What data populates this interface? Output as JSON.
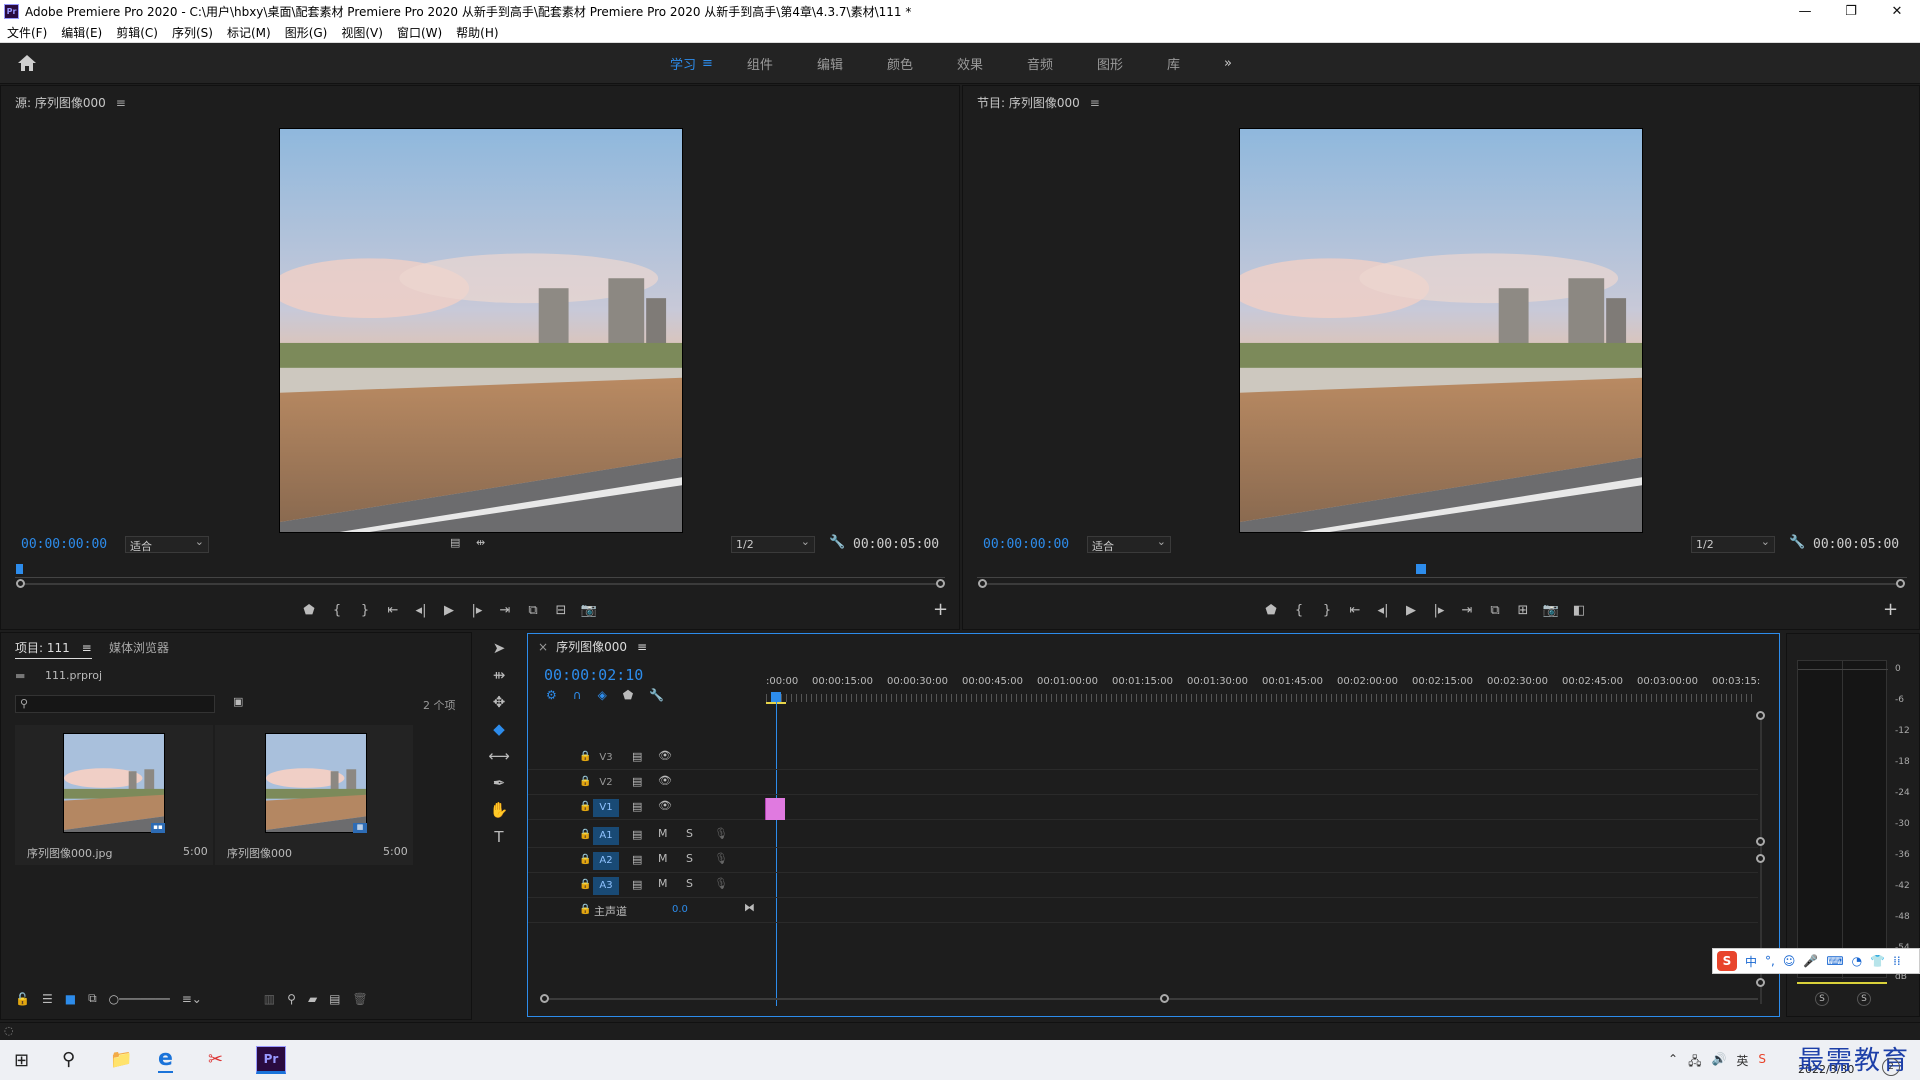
{
  "window": {
    "title": "Adobe Premiere Pro 2020 - C:\\用户\\hbxy\\桌面\\配套素材 Premiere Pro 2020 从新手到高手\\配套素材 Premiere Pro 2020 从新手到高手\\第4章\\4.3.7\\素材\\111 *",
    "app_icon_label": "Pr",
    "minimize": "—",
    "restore": "❐",
    "close": "✕"
  },
  "menu": [
    "文件(F)",
    "编辑(E)",
    "剪辑(C)",
    "序列(S)",
    "标记(M)",
    "图形(G)",
    "视图(V)",
    "窗口(W)",
    "帮助(H)"
  ],
  "workspaces": {
    "items": [
      "学习",
      "组件",
      "编辑",
      "颜色",
      "效果",
      "音频",
      "图形",
      "库"
    ],
    "active": "学习",
    "more": "»"
  },
  "source_monitor": {
    "title": "源: 序列图像000",
    "menu_icon": "≡",
    "timecode_in": "00:00:00:00",
    "fit": "适合",
    "resolution": "1/2",
    "duration": "00:00:05:00"
  },
  "program_monitor": {
    "title": "节目: 序列图像000",
    "menu_icon": "≡",
    "timecode_in": "00:00:00:00",
    "fit": "适合",
    "resolution": "1/2",
    "duration": "00:00:05:00"
  },
  "project": {
    "tab_project": "项目: 111",
    "tab_menu": "≡",
    "tab_media": "媒体浏览器",
    "file": "111.prproj",
    "count": "2 个项",
    "items": [
      {
        "name": "序列图像000.jpg",
        "duration": "5:00"
      },
      {
        "name": "序列图像000",
        "duration": "5:00"
      }
    ]
  },
  "timeline": {
    "tab": "序列图像000",
    "tab_menu": "≡",
    "timecode": "00:00:02:10",
    "ruler": [
      ":00:00",
      "00:00:15:00",
      "00:00:30:00",
      "00:00:45:00",
      "00:01:00:00",
      "00:01:15:00",
      "00:01:30:00",
      "00:01:45:00",
      "00:02:00:00",
      "00:02:15:00",
      "00:02:30:00",
      "00:02:45:00",
      "00:03:00:00",
      "00:03:15:"
    ],
    "video_tracks": [
      "V3",
      "V2",
      "V1"
    ],
    "audio_tracks": [
      "A1",
      "A2",
      "A3"
    ],
    "mute": "M",
    "solo": "S",
    "master": "主声道",
    "master_value": "0.0"
  },
  "meters": {
    "scale": [
      "0",
      "-6",
      "-12",
      "-18",
      "-24",
      "-30",
      "-36",
      "-42",
      "-48",
      "-54"
    ],
    "db": "dB",
    "solo_l": "S",
    "solo_r": "S"
  },
  "ime": {
    "items": [
      "中",
      "°,",
      "☺",
      "🎤",
      "⌨",
      "◔",
      "👕",
      "⁞⁞"
    ]
  },
  "taskbar": {
    "date": "2022/3/30",
    "watermark": "最需教育"
  },
  "colors": {
    "accent": "#2d8ceb",
    "clip_pink": "#e07ae0",
    "panel_bg": "#1d1d1d"
  }
}
